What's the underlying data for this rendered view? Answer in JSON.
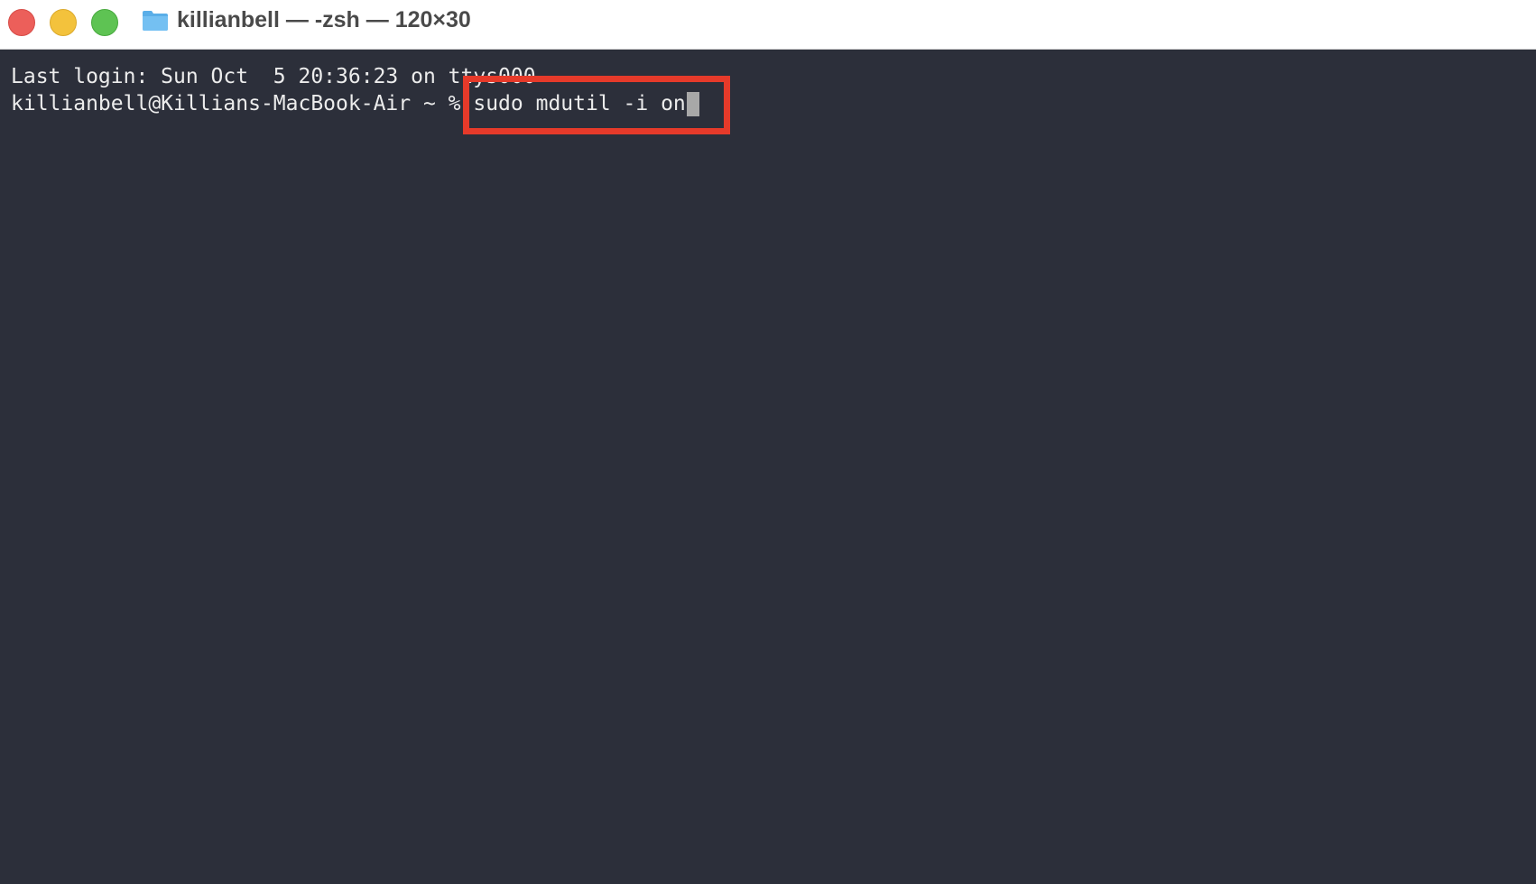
{
  "window": {
    "title": "killianbell — -zsh — 120×30",
    "icons": {
      "close": "close-button",
      "minimize": "minimize-button",
      "zoom": "zoom-button",
      "folder": "folder-icon"
    }
  },
  "terminal": {
    "last_login_line": "Last login: Sun Oct  5 20:36:23 on ttys000",
    "prompt": "killianbell@Killians-MacBook-Air ~ % ",
    "command": "sudo mdutil -i on"
  },
  "colors": {
    "terminal_background": "#2c2f3a",
    "terminal_text": "#ececec",
    "highlight": "#e63a2a",
    "cursor": "#a8a8a8"
  }
}
